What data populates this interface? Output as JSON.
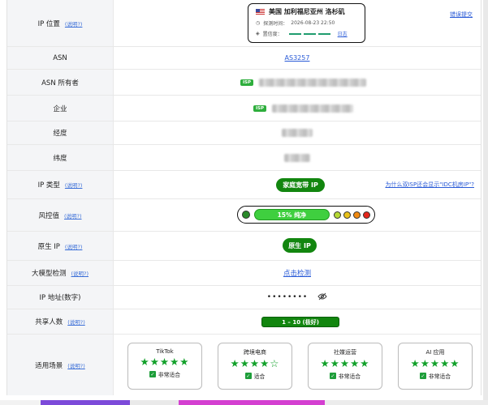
{
  "rows": {
    "ip_location": {
      "label": "IP 位置",
      "help": "(说明?)",
      "country_city": "美国 加利福尼亚州 洛杉矶",
      "detect_label": "探测时间：",
      "detect_time": "2026-08-23 22:50",
      "confidence_label": "置信度：",
      "log_link": "日志",
      "report_link": "错误提交"
    },
    "asn": {
      "label": "ASN",
      "value": "AS3257"
    },
    "asn_owner": {
      "label": "ASN 所有者",
      "tag": "ISP"
    },
    "company": {
      "label": "企业",
      "tag": "ISP"
    },
    "longitude": {
      "label": "经度"
    },
    "latitude": {
      "label": "纬度"
    },
    "ip_type": {
      "label": "IP 类型",
      "help": "(说明?)",
      "value": "家庭宽带 IP",
      "link": "为什么双ISP还会显示\"IDC机房IP\"?"
    },
    "risk": {
      "label": "风控值",
      "help": "(说明?)",
      "value": "15%  纯净",
      "score_percent": 15
    },
    "native_ip": {
      "label": "原生 IP",
      "help": "(说明?)",
      "value": "原生 IP"
    },
    "llm_detect": {
      "label": "大模型检测",
      "help": "(说明?)",
      "value": "点击检测"
    },
    "ip_numeric": {
      "label": "IP 地址(数字)",
      "value": "••••••••"
    },
    "shared": {
      "label": "共享人数",
      "help": "(说明?)",
      "value": "1 – 10 (极好)"
    },
    "scenarios": {
      "label": "适用场景",
      "help": "(说明?)",
      "cards": [
        {
          "name": "TikTok",
          "stars": "★★★★★",
          "fit": "非常适合"
        },
        {
          "name": "跨境电商",
          "stars": "★★★★☆",
          "fit": "适合"
        },
        {
          "name": "社媒运营",
          "stars": "★★★★★",
          "fit": "非常适合"
        },
        {
          "name": "AI 应用",
          "stars": "★★★★★",
          "fit": "非常适合"
        }
      ]
    }
  },
  "colors": {
    "green": "#12860f",
    "link": "#2a5bd7",
    "risk_left": "#2a8a2a",
    "risk_dots": [
      "#b6d935",
      "#e8c21c",
      "#f08a12",
      "#e4261c"
    ]
  }
}
